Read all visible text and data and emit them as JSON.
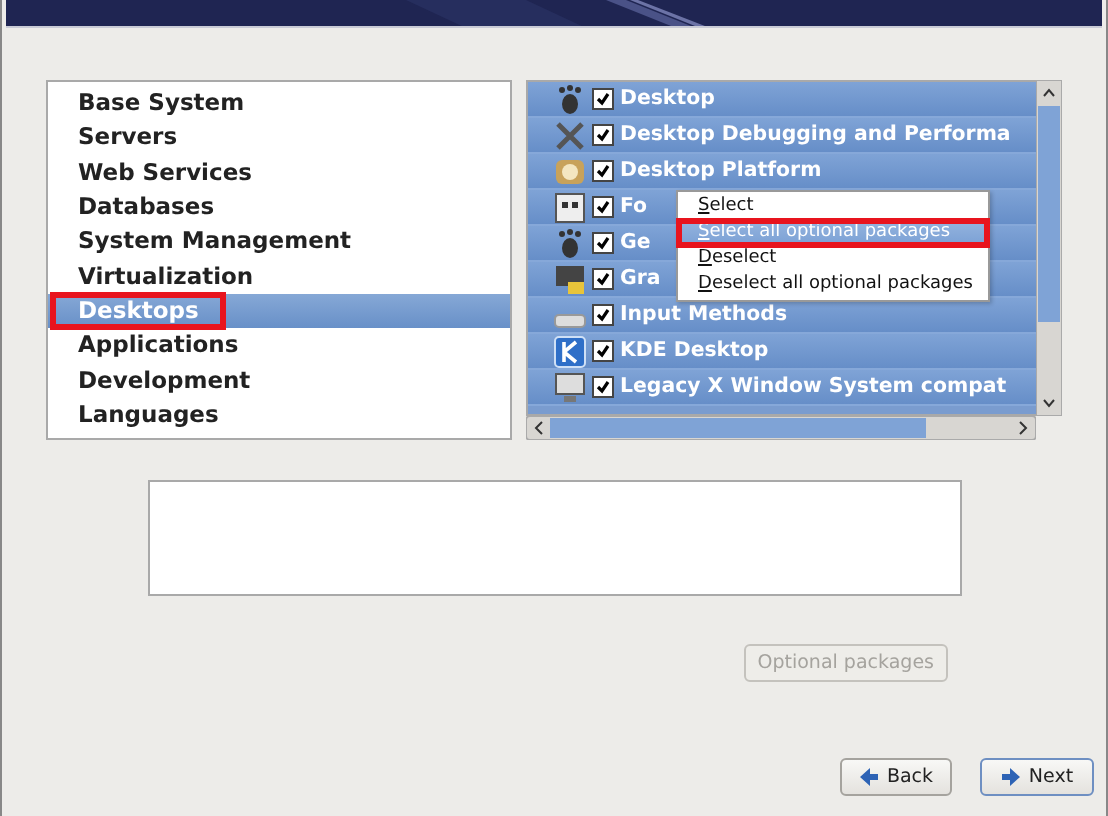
{
  "groups": [
    {
      "label": "Base System",
      "selected": false,
      "highlighted": false
    },
    {
      "label": "Servers",
      "selected": false,
      "highlighted": false
    },
    {
      "label": "Web Services",
      "selected": false,
      "highlighted": false
    },
    {
      "label": "Databases",
      "selected": false,
      "highlighted": false
    },
    {
      "label": "System Management",
      "selected": false,
      "highlighted": false
    },
    {
      "label": "Virtualization",
      "selected": false,
      "highlighted": false
    },
    {
      "label": "Desktops",
      "selected": true,
      "highlighted": true
    },
    {
      "label": "Applications",
      "selected": false,
      "highlighted": false
    },
    {
      "label": "Development",
      "selected": false,
      "highlighted": false
    },
    {
      "label": "Languages",
      "selected": false,
      "highlighted": false
    }
  ],
  "packages": [
    {
      "kind": "foot",
      "label": "Desktop",
      "checked": true
    },
    {
      "kind": "tools",
      "label": "Desktop Debugging and Performa",
      "checked": true
    },
    {
      "kind": "platform",
      "label": "Desktop Platform",
      "checked": true
    },
    {
      "kind": "fonts",
      "label": "Fo",
      "checked": true
    },
    {
      "kind": "foot",
      "label": "Ge",
      "checked": true
    },
    {
      "kind": "lock",
      "label": "Gra",
      "checked": true
    },
    {
      "kind": "keyboard",
      "label": "Input Methods",
      "checked": true
    },
    {
      "kind": "kde",
      "label": "KDE Desktop",
      "checked": true
    },
    {
      "kind": "monitor",
      "label": "Legacy X Window System compat",
      "checked": true
    }
  ],
  "context_menu": [
    {
      "label": "Select",
      "selected": false,
      "highlighted": false
    },
    {
      "label": "Select all optional packages",
      "selected": true,
      "highlighted": true
    },
    {
      "label": "Deselect",
      "selected": false,
      "highlighted": false
    },
    {
      "label": "Deselect all optional packages",
      "selected": false,
      "highlighted": false
    }
  ],
  "optional_button": {
    "label": "Optional packages",
    "disabled": true
  },
  "buttons": [
    {
      "kind": "back",
      "label": "Back"
    },
    {
      "kind": "next",
      "label": "Next"
    }
  ]
}
